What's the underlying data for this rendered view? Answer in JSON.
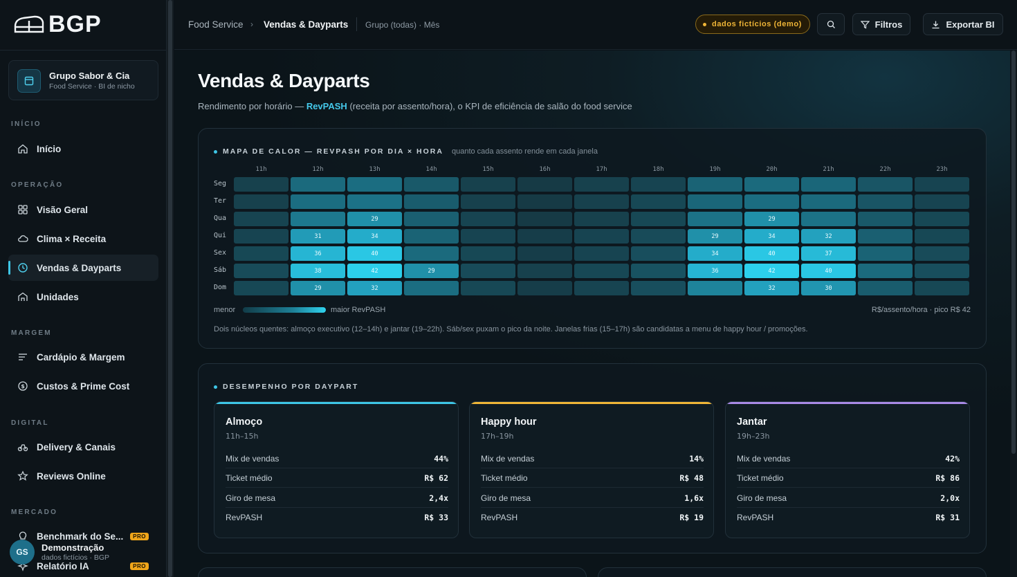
{
  "brand": {
    "logo_text": "BGP"
  },
  "org": {
    "name": "Grupo Sabor & Cia",
    "subtitle": "Food Service · BI de nicho"
  },
  "sidebar": {
    "sections": [
      {
        "label": "INÍCIO"
      },
      {
        "label": "OPERAÇÃO"
      },
      {
        "label": "MARGEM"
      },
      {
        "label": "DIGITAL"
      },
      {
        "label": "MERCADO"
      }
    ],
    "items": [
      {
        "label": "Início",
        "icon": "home-icon"
      },
      {
        "label": "Visão Geral",
        "icon": "grid-icon"
      },
      {
        "label": "Clima × Receita",
        "icon": "cloud-icon"
      },
      {
        "label": "Vendas & Dayparts",
        "icon": "clock-icon",
        "active": true
      },
      {
        "label": "Unidades",
        "icon": "store-icon"
      },
      {
        "label": "Cardápio & Margem",
        "icon": "menu-list-icon"
      },
      {
        "label": "Custos & Prime Cost",
        "icon": "coin-icon"
      },
      {
        "label": "Delivery & Canais",
        "icon": "bike-icon"
      },
      {
        "label": "Reviews Online",
        "icon": "star-icon"
      },
      {
        "label": "Benchmark do Se...",
        "icon": "bulb-icon",
        "badge": "PRO"
      },
      {
        "label": "Relatório IA",
        "icon": "sparkle-icon",
        "badge": "PRO"
      }
    ]
  },
  "user": {
    "initials": "GS",
    "name": "Demonstração",
    "subtitle": "dados fictícios · BGP"
  },
  "topbar": {
    "breadcrumb": [
      "Food Service",
      "Vendas & Dayparts"
    ],
    "context": "Grupo (todas) · Mês",
    "demo_badge": "dados fictícios (demo)",
    "filters_label": "Filtros",
    "export_label": "Exportar BI"
  },
  "page": {
    "title": "Vendas & Dayparts",
    "subtitle_pre": "Rendimento por horário — ",
    "subtitle_hl": "RevPASH",
    "subtitle_post": " (receita por assento/hora), o KPI de eficiência de salão do food service"
  },
  "heatmap": {
    "title": "MAPA DE CALOR — REVPASH POR DIA × HORA",
    "subtitle": "quanto cada assento rende em cada janela",
    "hours": [
      "11h",
      "12h",
      "13h",
      "14h",
      "15h",
      "16h",
      "17h",
      "18h",
      "19h",
      "20h",
      "21h",
      "22h",
      "23h"
    ],
    "days": [
      "Seg",
      "Ter",
      "Qua",
      "Qui",
      "Sex",
      "Sáb",
      "Dom"
    ],
    "legend_min": "menor",
    "legend_max": "maior RevPASH",
    "unit_note": "R$/assento/hora · pico R$ 42",
    "note": "Dois núcleos quentes: almoço executivo (12–14h) e jantar (19–22h). Sáb/sex puxam o pico da noite. Janelas frias (15–17h) são candidatas a menu de happy hour / promoções."
  },
  "chart_data": {
    "type": "heatmap",
    "x": [
      "11h",
      "12h",
      "13h",
      "14h",
      "15h",
      "16h",
      "17h",
      "18h",
      "19h",
      "20h",
      "21h",
      "22h",
      "23h"
    ],
    "y": [
      "Seg",
      "Ter",
      "Qua",
      "Qui",
      "Sex",
      "Sáb",
      "Dom"
    ],
    "values": [
      [
        10,
        22,
        23,
        17,
        10,
        8,
        10,
        11,
        20,
        22,
        21,
        16,
        11
      ],
      [
        10,
        23,
        24,
        18,
        10,
        8,
        10,
        12,
        21,
        23,
        22,
        16,
        11
      ],
      [
        11,
        25,
        29,
        19,
        11,
        8,
        10,
        12,
        24,
        29,
        24,
        17,
        12
      ],
      [
        11,
        31,
        34,
        20,
        11,
        9,
        11,
        13,
        29,
        34,
        32,
        19,
        12
      ],
      [
        12,
        36,
        40,
        22,
        12,
        9,
        11,
        14,
        34,
        40,
        37,
        20,
        13
      ],
      [
        13,
        38,
        42,
        29,
        13,
        10,
        12,
        15,
        36,
        42,
        40,
        22,
        14
      ],
      [
        12,
        29,
        32,
        23,
        12,
        9,
        11,
        14,
        27,
        32,
        30,
        18,
        12
      ]
    ],
    "labeled_values": [
      [
        null,
        null,
        null,
        null,
        null,
        null,
        null,
        null,
        null,
        null,
        null,
        null,
        null
      ],
      [
        null,
        null,
        null,
        null,
        null,
        null,
        null,
        null,
        null,
        null,
        null,
        null,
        null
      ],
      [
        null,
        null,
        29,
        null,
        null,
        null,
        null,
        null,
        null,
        29,
        null,
        null,
        null
      ],
      [
        null,
        31,
        34,
        null,
        null,
        null,
        null,
        null,
        29,
        34,
        32,
        null,
        null
      ],
      [
        null,
        36,
        40,
        null,
        null,
        null,
        null,
        null,
        34,
        40,
        37,
        null,
        null
      ],
      [
        null,
        38,
        42,
        29,
        null,
        null,
        null,
        null,
        36,
        42,
        40,
        null,
        null
      ],
      [
        null,
        29,
        32,
        null,
        null,
        null,
        null,
        null,
        null,
        32,
        30,
        null,
        null
      ]
    ],
    "max": 42
  },
  "dayparts": {
    "title": "DESEMPENHO POR DAYPART",
    "row_labels": {
      "mix": "Mix de vendas",
      "ticket": "Ticket médio",
      "giro": "Giro de mesa",
      "revpash": "RevPASH"
    },
    "items": [
      {
        "name": "Almoço",
        "range": "11h–15h",
        "accent": "#3ec6e6",
        "mix": "44%",
        "ticket": "R$ 62",
        "giro": "2,4x",
        "revpash": "R$ 33"
      },
      {
        "name": "Happy hour",
        "range": "17h–19h",
        "accent": "#f0b637",
        "mix": "14%",
        "ticket": "R$ 48",
        "giro": "1,6x",
        "revpash": "R$ 19"
      },
      {
        "name": "Jantar",
        "range": "19h–23h",
        "accent": "#a98ae6",
        "mix": "42%",
        "ticket": "R$ 86",
        "giro": "2,0x",
        "revpash": "R$ 31"
      }
    ]
  }
}
